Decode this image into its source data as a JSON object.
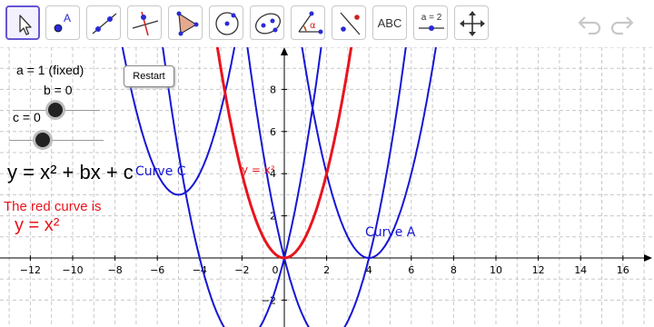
{
  "toolbar": {
    "tools": [
      {
        "name": "move-tool",
        "label": ""
      },
      {
        "name": "point-tool",
        "label": "A"
      },
      {
        "name": "line-tool",
        "label": ""
      },
      {
        "name": "perpendicular-line-tool",
        "label": ""
      },
      {
        "name": "polygon-tool",
        "label": ""
      },
      {
        "name": "circle-with-center-tool",
        "label": ""
      },
      {
        "name": "ellipse-tool",
        "label": ""
      },
      {
        "name": "angle-tool",
        "label": "α"
      },
      {
        "name": "reflect-about-line-tool",
        "label": ""
      },
      {
        "name": "text-tool",
        "label": "ABC"
      },
      {
        "name": "slider-tool",
        "label": "a = 2"
      },
      {
        "name": "move-graphics-view-tool",
        "label": ""
      }
    ],
    "undo_icon": "undo-icon",
    "redo_icon": "redo-icon"
  },
  "params": {
    "a_label": "a = 1  (fixed)",
    "b_label": "b = 0",
    "c_label": "c = 0",
    "b_value": 0,
    "c_value": 0
  },
  "restart_label": "Restart",
  "equation_label": "y = x² + bx + c",
  "red_curve_caption": "The red curve is",
  "red_curve_equation": "y = x²",
  "curve_labels": {
    "curve_c": "Curve C",
    "curve_red": "y = x²",
    "curve_a": "Curve A"
  },
  "colors": {
    "red_curve": "#e8141e",
    "blue_curve": "#1616d4",
    "grid": "#c8c8c8",
    "selected_tool": "#6557d2"
  },
  "axes": {
    "x_ticks": [
      "−12",
      "−10",
      "−8",
      "−6",
      "−4",
      "−2",
      "0",
      "2",
      "4",
      "6",
      "8",
      "10",
      "12",
      "14",
      "16"
    ],
    "y_ticks": [
      "8",
      "6",
      "4",
      "2",
      "−2"
    ]
  },
  "chart_data": {
    "type": "line",
    "xlim": [
      -13.3,
      17.5
    ],
    "ylim": [
      -2.8,
      10.3
    ],
    "grid": true,
    "series": [
      {
        "name": "y = x²",
        "equation": "y = x^2"
      },
      {
        "name": "Curve A",
        "equation": "y = (x - 4)^2"
      },
      {
        "name": "Curve C",
        "equation": "y = (x + 5)^2 + 3"
      },
      {
        "equation": "y = (x - 2)^2 - 4"
      },
      {
        "equation": "y = (x + 2)^2 - 4"
      }
    ]
  }
}
